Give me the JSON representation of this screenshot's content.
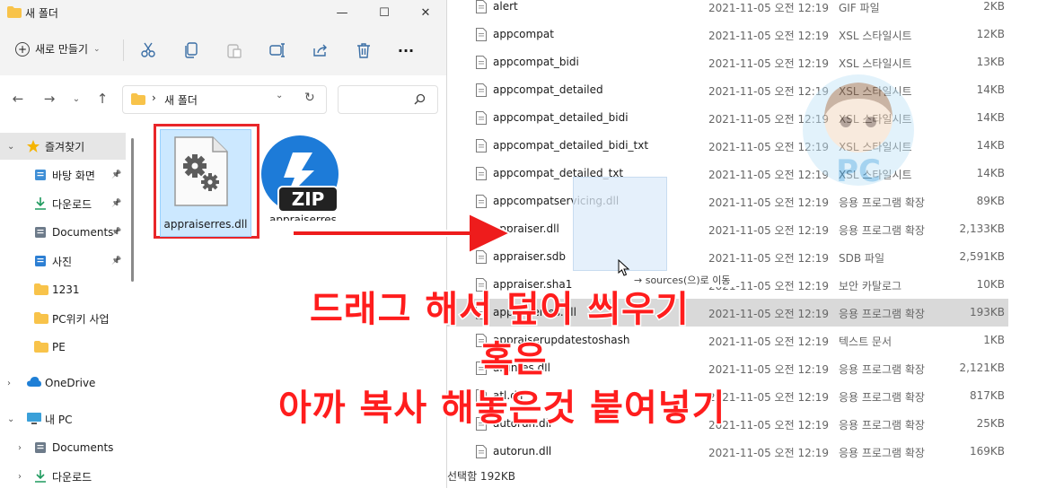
{
  "left_window": {
    "title": "새 폴더",
    "toolbar": {
      "new_label": "새로 만들기"
    },
    "address": {
      "path_sep": "›",
      "folder": "새 폴더"
    },
    "nav": [
      {
        "label": "즐겨찾기",
        "icon": "star-icon"
      },
      {
        "label": "바탕 화면",
        "icon": "desktop-icon"
      },
      {
        "label": "다운로드",
        "icon": "download-icon"
      },
      {
        "label": "Documents",
        "icon": "documents-icon"
      },
      {
        "label": "사진",
        "icon": "pictures-icon"
      },
      {
        "label": "1231",
        "icon": "folder-icon"
      },
      {
        "label": "PC위키 사업",
        "icon": "folder-icon"
      },
      {
        "label": "PE",
        "icon": "folder-icon"
      },
      {
        "label": "OneDrive",
        "icon": "cloud-icon"
      },
      {
        "label": "내 PC",
        "icon": "pc-icon"
      },
      {
        "label": "Documents",
        "icon": "documents-icon"
      },
      {
        "label": "다운로드",
        "icon": "download-icon"
      }
    ],
    "files": [
      {
        "name": "appraiserres.dll",
        "icon": "dll-gear-icon"
      },
      {
        "name": "appraiserres",
        "icon": "zip-icon"
      }
    ]
  },
  "right_window": {
    "rows": [
      {
        "name": "alert",
        "date": "2021-11-05 오전 12:19",
        "type": "GIF 파일",
        "size": "2KB"
      },
      {
        "name": "appcompat",
        "date": "2021-11-05 오전 12:19",
        "type": "XSL 스타일시트",
        "size": "12KB"
      },
      {
        "name": "appcompat_bidi",
        "date": "2021-11-05 오전 12:19",
        "type": "XSL 스타일시트",
        "size": "13KB"
      },
      {
        "name": "appcompat_detailed",
        "date": "2021-11-05 오전 12:19",
        "type": "XSL 스타일시트",
        "size": "14KB"
      },
      {
        "name": "appcompat_detailed_bidi",
        "date": "2021-11-05 오전 12:19",
        "type": "XSL 스타일시트",
        "size": "14KB"
      },
      {
        "name": "appcompat_detailed_bidi_txt",
        "date": "2021-11-05 오전 12:19",
        "type": "XSL 스타일시트",
        "size": "14KB"
      },
      {
        "name": "appcompat_detailed_txt",
        "date": "2021-11-05 오전 12:19",
        "type": "XSL 스타일시트",
        "size": "14KB"
      },
      {
        "name": "appcompatservicing.dll",
        "date": "2021-11-05 오전 12:19",
        "type": "응용 프로그램 확장",
        "size": "89KB"
      },
      {
        "name": "appraiser.dll",
        "date": "2021-11-05 오전 12:19",
        "type": "응용 프로그램 확장",
        "size": "2,133KB"
      },
      {
        "name": "appraiser.sdb",
        "date": "2021-11-05 오전 12:19",
        "type": "SDB 파일",
        "size": "2,591KB"
      },
      {
        "name": "appraiser.sha1",
        "date": "2021-11-05 오전 12:19",
        "type": "보안 카탈로그",
        "size": "10KB"
      },
      {
        "name": "appraiserres.dll",
        "date": "2021-11-05 오전 12:19",
        "type": "응용 프로그램 확장",
        "size": "193KB",
        "selected": true
      },
      {
        "name": "appraiserupdatestoshash",
        "date": "2021-11-05 오전 12:19",
        "type": "텍스트 문서",
        "size": "1KB"
      },
      {
        "name": "arunres.dll",
        "date": "2021-11-05 오전 12:19",
        "type": "응용 프로그램 확장",
        "size": "2,121KB"
      },
      {
        "name": "atl.dll",
        "date": "2021-11-05 오전 12:19",
        "type": "응용 프로그램 확장",
        "size": "817KB"
      },
      {
        "name": "autorun.dll",
        "date": "2021-11-05 오전 12:19",
        "type": "응용 프로그램 확장",
        "size": "25KB"
      },
      {
        "name": "autorun.dll",
        "date": "2021-11-05 오전 12:19",
        "type": "응용 프로그램 확장",
        "size": "169KB"
      }
    ],
    "status": "선택함 192KB",
    "drag_tooltip": "→ sources(으)로 이동"
  },
  "overlay": {
    "line1": "드래그 해서 덮어 씌우기",
    "line2": "혹은",
    "line3": "아까 복사 해놓은것 붙여넣기"
  },
  "colors": {
    "highlight": "#e8262a",
    "caption": "#ff1d1d",
    "selection": "#cce8ff"
  }
}
